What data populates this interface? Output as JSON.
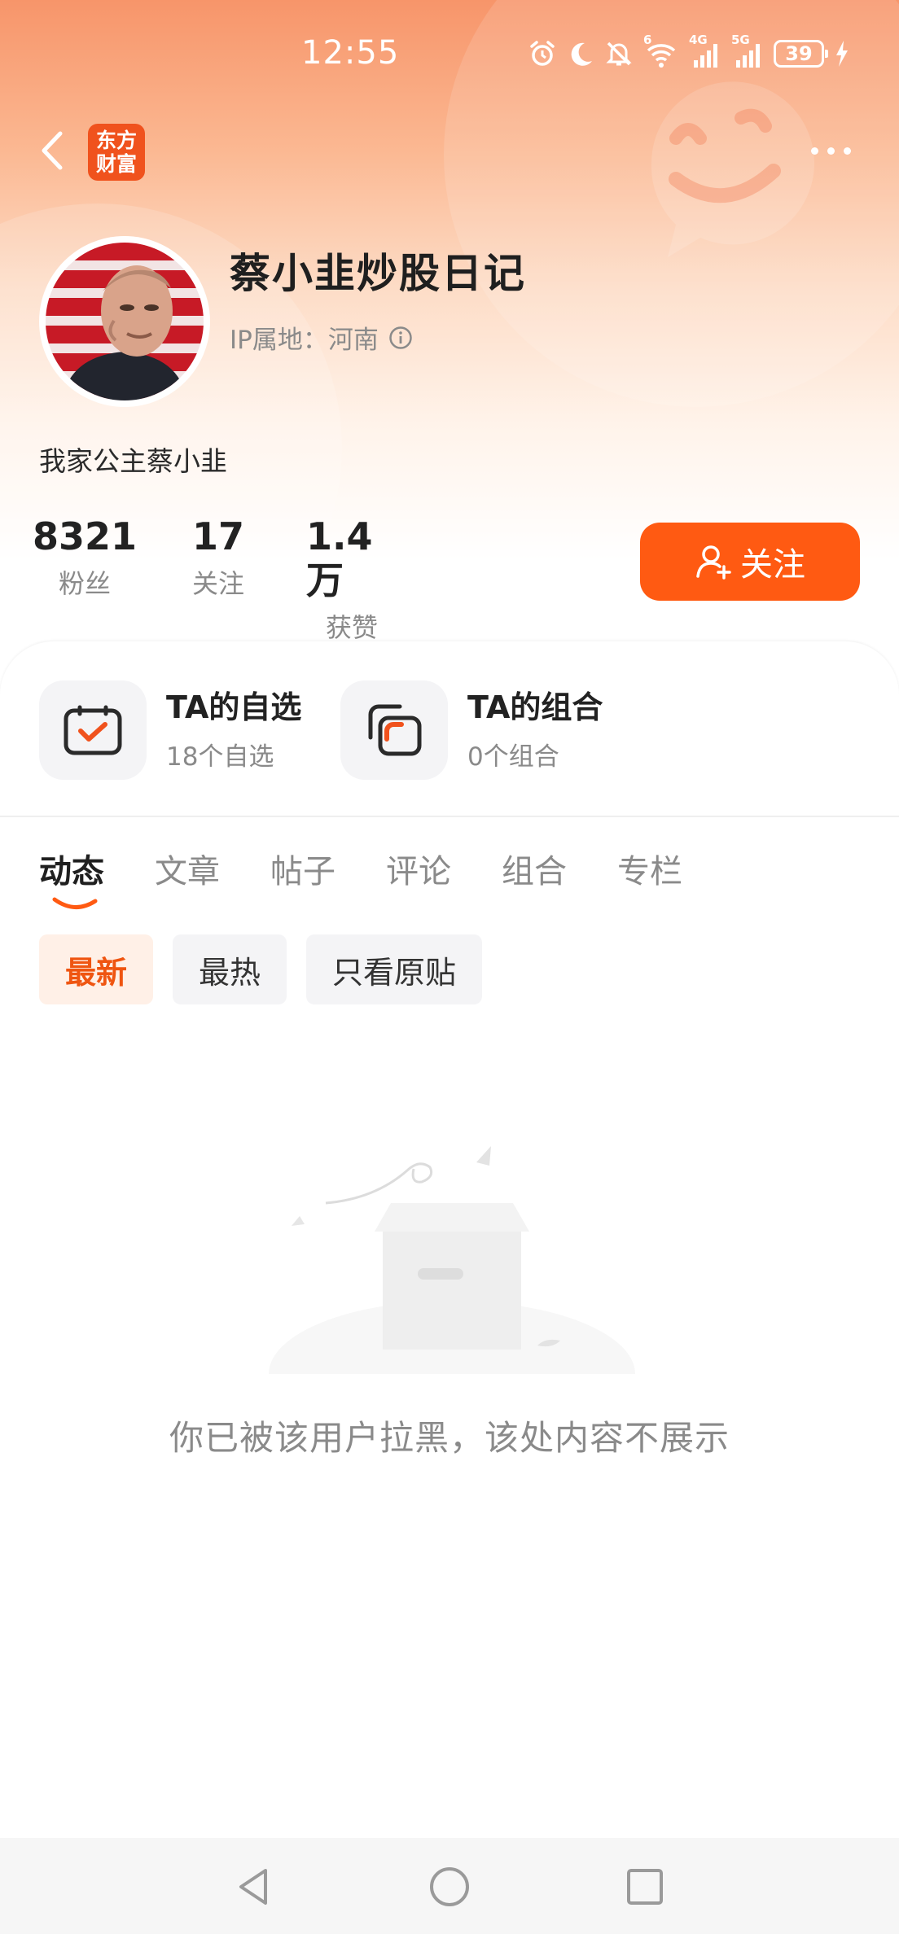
{
  "status_bar": {
    "time": "12:55",
    "battery": "39",
    "network_1": "4G",
    "network_2": "5G",
    "wifi_badge": "6",
    "icons": [
      "alarm-icon",
      "moon-icon",
      "mute-icon",
      "wifi-icon",
      "signal-icon",
      "signal-icon",
      "battery-icon",
      "charging-icon"
    ]
  },
  "nav": {
    "back_icon": "chevron-left-icon",
    "logo_line1": "东方",
    "logo_line2": "财富",
    "more_icon": "more-icon"
  },
  "profile": {
    "name": "蔡小韭炒股日记",
    "ip_location": "IP属地：河南",
    "bio": "我家公主蔡小韭",
    "stats": [
      {
        "value": "8321",
        "label": "粉丝"
      },
      {
        "value": "17",
        "label": "关注"
      },
      {
        "value": "1.4万",
        "label": "获赞"
      }
    ],
    "follow_label": "关注"
  },
  "quick_entries": [
    {
      "title": "TA的自选",
      "subtitle": "18个自选",
      "icon": "watchlist-icon"
    },
    {
      "title": "TA的组合",
      "subtitle": "0个组合",
      "icon": "portfolio-icon"
    }
  ],
  "tabs": [
    {
      "label": "动态",
      "active": true
    },
    {
      "label": "文章",
      "active": false
    },
    {
      "label": "帖子",
      "active": false
    },
    {
      "label": "评论",
      "active": false
    },
    {
      "label": "组合",
      "active": false
    },
    {
      "label": "专栏",
      "active": false
    }
  ],
  "filters": [
    {
      "label": "最新",
      "active": true
    },
    {
      "label": "最热",
      "active": false
    },
    {
      "label": "只看原贴",
      "active": false
    }
  ],
  "empty_state": {
    "icon": "empty-box-icon",
    "message": "你已被该用户拉黑，该处内容不展示"
  },
  "colors": {
    "accent": "#ff5a12",
    "accent_soft": "#fff0e7",
    "header_gradient_top": "#f7956a",
    "text_primary": "#1f1f1f",
    "text_secondary": "#8a8a8a"
  },
  "system_nav": [
    "back-triangle-icon",
    "home-circle-icon",
    "recents-square-icon"
  ]
}
